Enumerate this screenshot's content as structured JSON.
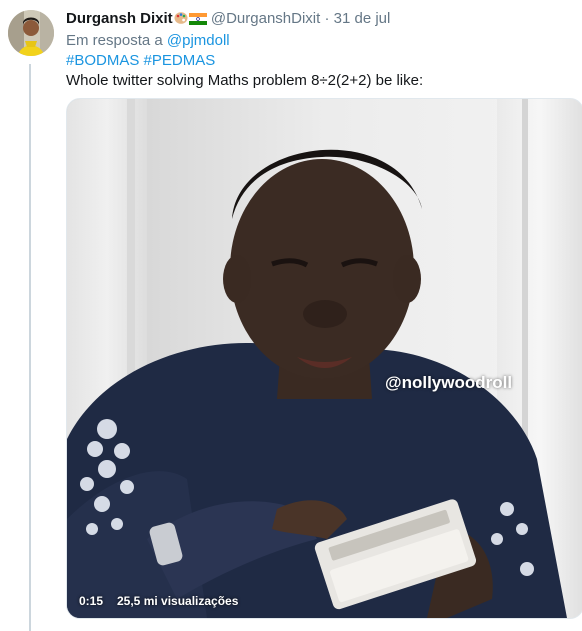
{
  "tweet": {
    "author_name": "Durgansh Dixit",
    "handle": "@DurganshDixit",
    "separator": "·",
    "date": "31 de jul",
    "reply_prefix": "Em resposta a",
    "reply_mention": "@pjmdoll",
    "hashtags": [
      "#BODMAS",
      "#PEDMAS"
    ],
    "text": "Whole twitter solving Maths problem 8÷2(2+2) be like:",
    "icons": [
      "palette-emoji-icon",
      "india-flag-icon"
    ]
  },
  "media": {
    "watermark": "@nollywoodroll",
    "elapsed": "0:15",
    "views": "25,5 mi visualizações"
  }
}
